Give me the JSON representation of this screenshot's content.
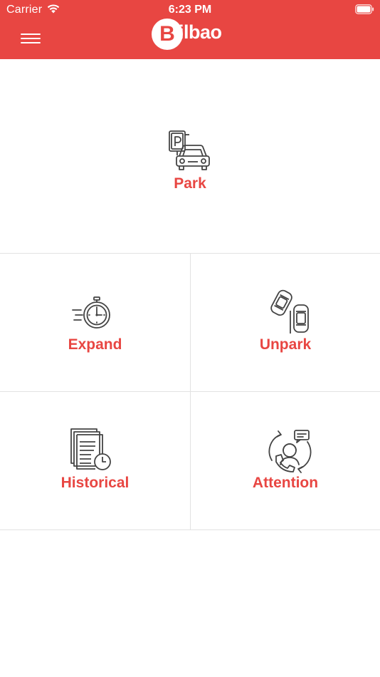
{
  "status_bar": {
    "carrier": "Carrier",
    "time": "6:23 PM"
  },
  "header": {
    "logo_letter": "B",
    "logo_rest": "ilbao",
    "menu_icon": "hamburger-menu-icon",
    "brand_color": "#e84642"
  },
  "menu": {
    "park": {
      "label": "Park",
      "icon": "parking-car-icon"
    },
    "expand": {
      "label": "Expand",
      "icon": "stopwatch-icon"
    },
    "unpark": {
      "label": "Unpark",
      "icon": "cars-leaving-icon"
    },
    "historical": {
      "label": "Historical",
      "icon": "documents-history-icon"
    },
    "attention": {
      "label": "Attention",
      "icon": "customer-support-icon"
    }
  }
}
